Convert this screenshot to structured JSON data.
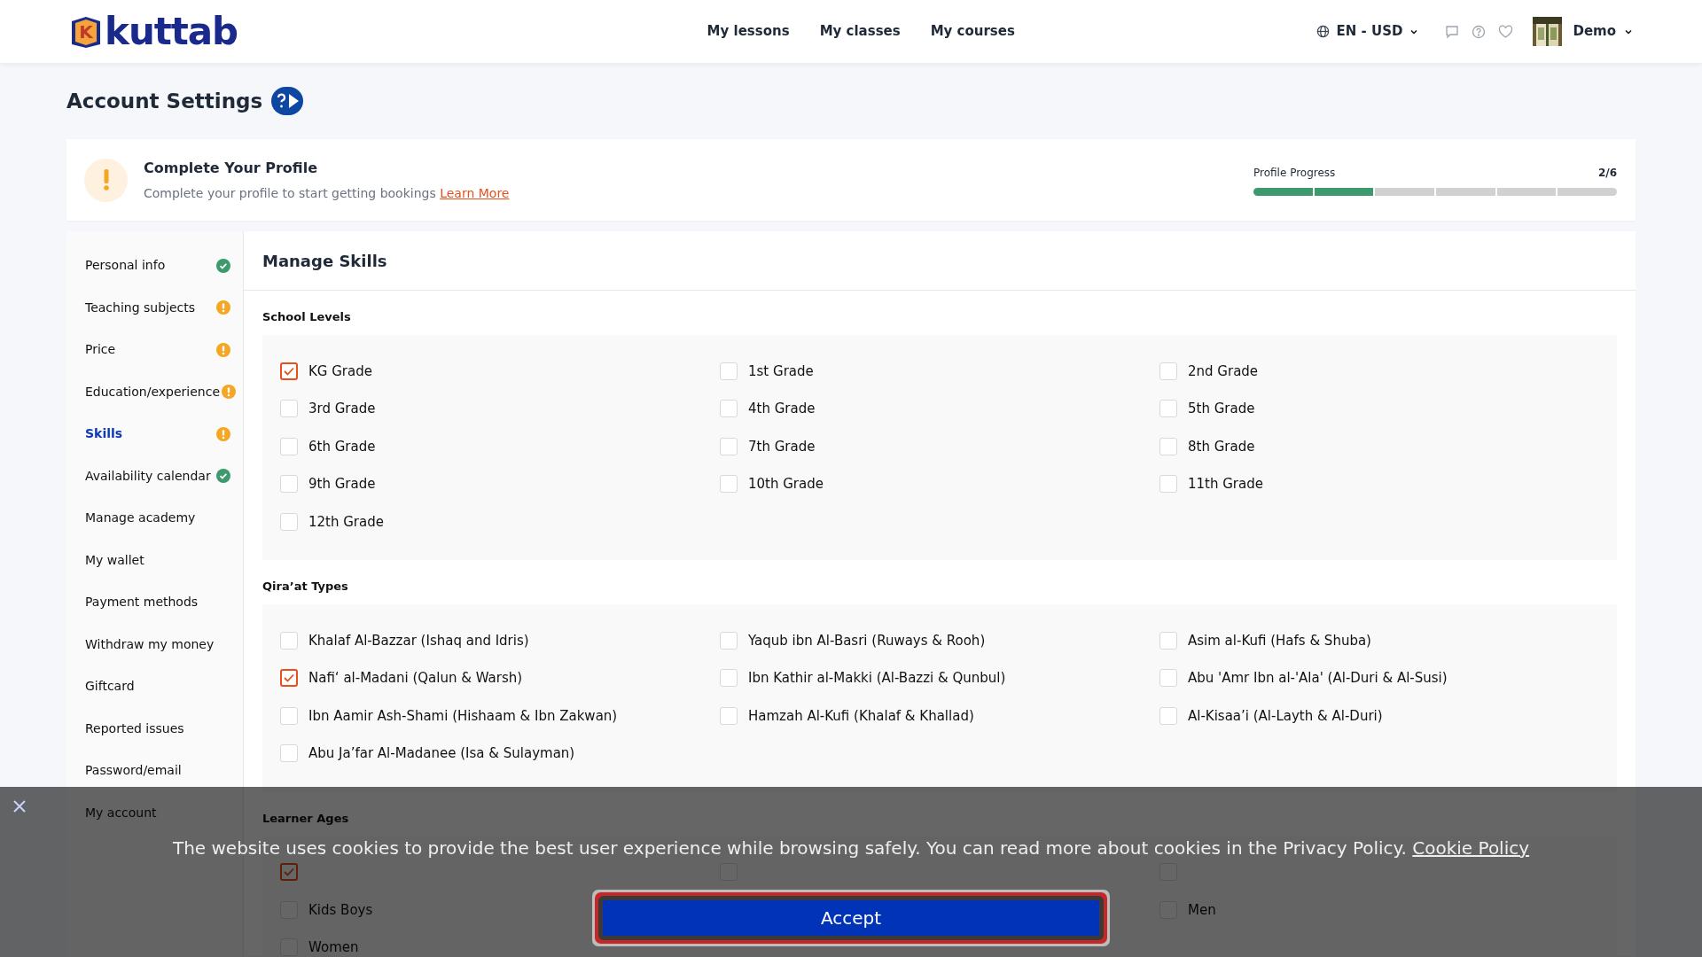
{
  "header": {
    "logo": {
      "mark": "K",
      "text": "kuttab"
    },
    "nav": [
      {
        "label": "My lessons"
      },
      {
        "label": "My classes"
      },
      {
        "label": "My courses"
      }
    ],
    "locale": "EN - USD",
    "user": "Demo"
  },
  "page_title": "Account Settings",
  "profile_banner": {
    "title": "Complete Your Profile",
    "text": "Complete your profile to start getting bookings",
    "link": "Learn More",
    "progress_label": "Profile Progress",
    "progress_count": "2/6",
    "steps": [
      {
        "done": true
      },
      {
        "done": true
      },
      {
        "done": false
      },
      {
        "done": false
      },
      {
        "done": false
      },
      {
        "done": false
      }
    ]
  },
  "sidebar": {
    "items": [
      {
        "label": "Personal info",
        "kind": "done",
        "selected": false
      },
      {
        "label": "Teaching subjects",
        "kind": "todo",
        "selected": false
      },
      {
        "label": "Price",
        "kind": "todo",
        "selected": false
      },
      {
        "label": "Education/experience",
        "kind": "todo",
        "selected": false
      },
      {
        "label": "Skills",
        "kind": "todo",
        "selected": true
      },
      {
        "label": "Availability calendar",
        "kind": "done",
        "selected": false
      },
      {
        "label": "Manage academy",
        "kind": "plain",
        "selected": false
      },
      {
        "label": "My wallet",
        "kind": "plain",
        "selected": false
      },
      {
        "label": "Payment methods",
        "kind": "plain",
        "selected": false
      },
      {
        "label": "Withdraw my money",
        "kind": "plain",
        "selected": false
      },
      {
        "label": "Giftcard",
        "kind": "plain",
        "selected": false
      },
      {
        "label": "Reported issues",
        "kind": "plain",
        "selected": false
      },
      {
        "label": "Password/email",
        "kind": "plain",
        "selected": false
      },
      {
        "label": "My account",
        "kind": "plain",
        "selected": false
      }
    ]
  },
  "panel": {
    "title": "Manage Skills",
    "sections": [
      {
        "title": "School Levels",
        "columns": [
          [
            {
              "label": "KG Grade",
              "checked": true
            },
            {
              "label": "3rd Grade",
              "checked": false
            },
            {
              "label": "6th Grade",
              "checked": false
            },
            {
              "label": "9th Grade",
              "checked": false
            },
            {
              "label": "12th Grade",
              "checked": false
            }
          ],
          [
            {
              "label": "1st Grade",
              "checked": false
            },
            {
              "label": "4th Grade",
              "checked": false
            },
            {
              "label": "7th Grade",
              "checked": false
            },
            {
              "label": "10th Grade",
              "checked": false
            }
          ],
          [
            {
              "label": "2nd Grade",
              "checked": false
            },
            {
              "label": "5th Grade",
              "checked": false
            },
            {
              "label": "8th Grade",
              "checked": false
            },
            {
              "label": "11th Grade",
              "checked": false
            }
          ]
        ]
      },
      {
        "title": "Qira’at Types",
        "columns": [
          [
            {
              "label": "Khalaf Al-Bazzar (Ishaq and Idris)",
              "checked": false
            },
            {
              "label": "Nafi‘ al-Madani (Qalun & Warsh)",
              "checked": true
            },
            {
              "label": "Ibn Aamir Ash-Shami (Hishaam & Ibn Zakwan)",
              "checked": false
            },
            {
              "label": "Abu Ja’far Al-Madanee (Isa & Sulayman)",
              "checked": false
            }
          ],
          [
            {
              "label": "Yaqub ibn Al-Basri (Ruways & Rooh)",
              "checked": false
            },
            {
              "label": "Ibn Kathir al-Makki (Al-Bazzi & Qunbul)",
              "checked": false
            },
            {
              "label": "Hamzah Al-Kufi (Khalaf & Khallad)",
              "checked": false
            }
          ],
          [
            {
              "label": "Asim al-Kufi (Hafs & Shuba)",
              "checked": false
            },
            {
              "label": "Abu 'Amr Ibn al-'Ala' (Al-Duri & Al-Susi)",
              "checked": false
            },
            {
              "label": "Al-Kisaa’i (Al-Layth & Al-Duri)",
              "checked": false
            }
          ]
        ]
      },
      {
        "title": "Learner Ages",
        "columns": [
          [
            {
              "checked": true
            },
            {
              "label": "Kids Boys",
              "checked": false
            },
            {
              "label": "Women",
              "checked": false
            }
          ],
          [
            {
              "checked": false
            }
          ],
          [
            {
              "checked": false
            },
            {
              "label": "Men",
              "checked": false
            }
          ]
        ]
      }
    ]
  },
  "cookie_banner": {
    "text": "The website uses cookies to provide the best user experience while browsing safely. You can read more about cookies in the Privacy Policy.",
    "link": "Cookie Policy",
    "button": "Accept"
  }
}
